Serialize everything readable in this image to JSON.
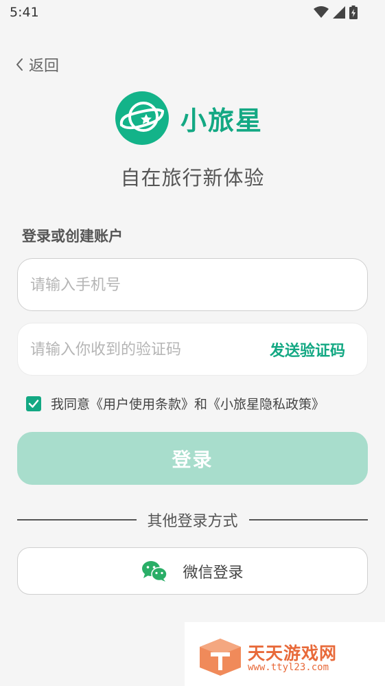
{
  "status_bar": {
    "time": "5:41",
    "icons": [
      "wifi-icon",
      "signal-icon",
      "battery-icon"
    ]
  },
  "nav": {
    "back_label": "返回"
  },
  "brand": {
    "app_name": "小旅星",
    "slogan": "自在旅行新体验",
    "accent_color": "#13a883"
  },
  "form": {
    "section_title": "登录或创建账户",
    "phone_placeholder": "请输入手机号",
    "code_placeholder": "请输入你收到的验证码",
    "send_code_label": "发送验证码",
    "agreement_text": "我同意《用户使用条款》和《小旅星隐私政策》",
    "agreement_checked": true,
    "login_label": "登录"
  },
  "other_login": {
    "divider_text": "其他登录方式",
    "wechat_label": "微信登录"
  },
  "watermark": {
    "name": "天天游戏网",
    "url": "www.ttyl23.com"
  }
}
